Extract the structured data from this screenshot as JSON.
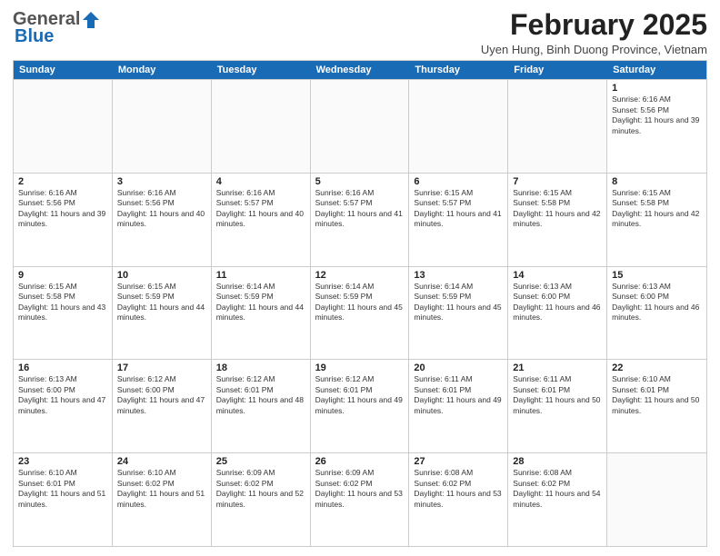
{
  "header": {
    "logo_general": "General",
    "logo_blue": "Blue",
    "title": "February 2025",
    "location": "Uyen Hung, Binh Duong Province, Vietnam"
  },
  "calendar": {
    "days_of_week": [
      "Sunday",
      "Monday",
      "Tuesday",
      "Wednesday",
      "Thursday",
      "Friday",
      "Saturday"
    ],
    "weeks": [
      [
        {
          "day": "",
          "empty": true
        },
        {
          "day": "",
          "empty": true
        },
        {
          "day": "",
          "empty": true
        },
        {
          "day": "",
          "empty": true
        },
        {
          "day": "",
          "empty": true
        },
        {
          "day": "",
          "empty": true
        },
        {
          "day": "1",
          "sunrise": "Sunrise: 6:16 AM",
          "sunset": "Sunset: 5:56 PM",
          "daylight": "Daylight: 11 hours and 39 minutes."
        }
      ],
      [
        {
          "day": "2",
          "sunrise": "Sunrise: 6:16 AM",
          "sunset": "Sunset: 5:56 PM",
          "daylight": "Daylight: 11 hours and 39 minutes."
        },
        {
          "day": "3",
          "sunrise": "Sunrise: 6:16 AM",
          "sunset": "Sunset: 5:56 PM",
          "daylight": "Daylight: 11 hours and 40 minutes."
        },
        {
          "day": "4",
          "sunrise": "Sunrise: 6:16 AM",
          "sunset": "Sunset: 5:57 PM",
          "daylight": "Daylight: 11 hours and 40 minutes."
        },
        {
          "day": "5",
          "sunrise": "Sunrise: 6:16 AM",
          "sunset": "Sunset: 5:57 PM",
          "daylight": "Daylight: 11 hours and 41 minutes."
        },
        {
          "day": "6",
          "sunrise": "Sunrise: 6:15 AM",
          "sunset": "Sunset: 5:57 PM",
          "daylight": "Daylight: 11 hours and 41 minutes."
        },
        {
          "day": "7",
          "sunrise": "Sunrise: 6:15 AM",
          "sunset": "Sunset: 5:58 PM",
          "daylight": "Daylight: 11 hours and 42 minutes."
        },
        {
          "day": "8",
          "sunrise": "Sunrise: 6:15 AM",
          "sunset": "Sunset: 5:58 PM",
          "daylight": "Daylight: 11 hours and 42 minutes."
        }
      ],
      [
        {
          "day": "9",
          "sunrise": "Sunrise: 6:15 AM",
          "sunset": "Sunset: 5:58 PM",
          "daylight": "Daylight: 11 hours and 43 minutes."
        },
        {
          "day": "10",
          "sunrise": "Sunrise: 6:15 AM",
          "sunset": "Sunset: 5:59 PM",
          "daylight": "Daylight: 11 hours and 44 minutes."
        },
        {
          "day": "11",
          "sunrise": "Sunrise: 6:14 AM",
          "sunset": "Sunset: 5:59 PM",
          "daylight": "Daylight: 11 hours and 44 minutes."
        },
        {
          "day": "12",
          "sunrise": "Sunrise: 6:14 AM",
          "sunset": "Sunset: 5:59 PM",
          "daylight": "Daylight: 11 hours and 45 minutes."
        },
        {
          "day": "13",
          "sunrise": "Sunrise: 6:14 AM",
          "sunset": "Sunset: 5:59 PM",
          "daylight": "Daylight: 11 hours and 45 minutes."
        },
        {
          "day": "14",
          "sunrise": "Sunrise: 6:13 AM",
          "sunset": "Sunset: 6:00 PM",
          "daylight": "Daylight: 11 hours and 46 minutes."
        },
        {
          "day": "15",
          "sunrise": "Sunrise: 6:13 AM",
          "sunset": "Sunset: 6:00 PM",
          "daylight": "Daylight: 11 hours and 46 minutes."
        }
      ],
      [
        {
          "day": "16",
          "sunrise": "Sunrise: 6:13 AM",
          "sunset": "Sunset: 6:00 PM",
          "daylight": "Daylight: 11 hours and 47 minutes."
        },
        {
          "day": "17",
          "sunrise": "Sunrise: 6:12 AM",
          "sunset": "Sunset: 6:00 PM",
          "daylight": "Daylight: 11 hours and 47 minutes."
        },
        {
          "day": "18",
          "sunrise": "Sunrise: 6:12 AM",
          "sunset": "Sunset: 6:01 PM",
          "daylight": "Daylight: 11 hours and 48 minutes."
        },
        {
          "day": "19",
          "sunrise": "Sunrise: 6:12 AM",
          "sunset": "Sunset: 6:01 PM",
          "daylight": "Daylight: 11 hours and 49 minutes."
        },
        {
          "day": "20",
          "sunrise": "Sunrise: 6:11 AM",
          "sunset": "Sunset: 6:01 PM",
          "daylight": "Daylight: 11 hours and 49 minutes."
        },
        {
          "day": "21",
          "sunrise": "Sunrise: 6:11 AM",
          "sunset": "Sunset: 6:01 PM",
          "daylight": "Daylight: 11 hours and 50 minutes."
        },
        {
          "day": "22",
          "sunrise": "Sunrise: 6:10 AM",
          "sunset": "Sunset: 6:01 PM",
          "daylight": "Daylight: 11 hours and 50 minutes."
        }
      ],
      [
        {
          "day": "23",
          "sunrise": "Sunrise: 6:10 AM",
          "sunset": "Sunset: 6:01 PM",
          "daylight": "Daylight: 11 hours and 51 minutes."
        },
        {
          "day": "24",
          "sunrise": "Sunrise: 6:10 AM",
          "sunset": "Sunset: 6:02 PM",
          "daylight": "Daylight: 11 hours and 51 minutes."
        },
        {
          "day": "25",
          "sunrise": "Sunrise: 6:09 AM",
          "sunset": "Sunset: 6:02 PM",
          "daylight": "Daylight: 11 hours and 52 minutes."
        },
        {
          "day": "26",
          "sunrise": "Sunrise: 6:09 AM",
          "sunset": "Sunset: 6:02 PM",
          "daylight": "Daylight: 11 hours and 53 minutes."
        },
        {
          "day": "27",
          "sunrise": "Sunrise: 6:08 AM",
          "sunset": "Sunset: 6:02 PM",
          "daylight": "Daylight: 11 hours and 53 minutes."
        },
        {
          "day": "28",
          "sunrise": "Sunrise: 6:08 AM",
          "sunset": "Sunset: 6:02 PM",
          "daylight": "Daylight: 11 hours and 54 minutes."
        },
        {
          "day": "",
          "empty": true
        }
      ]
    ]
  }
}
